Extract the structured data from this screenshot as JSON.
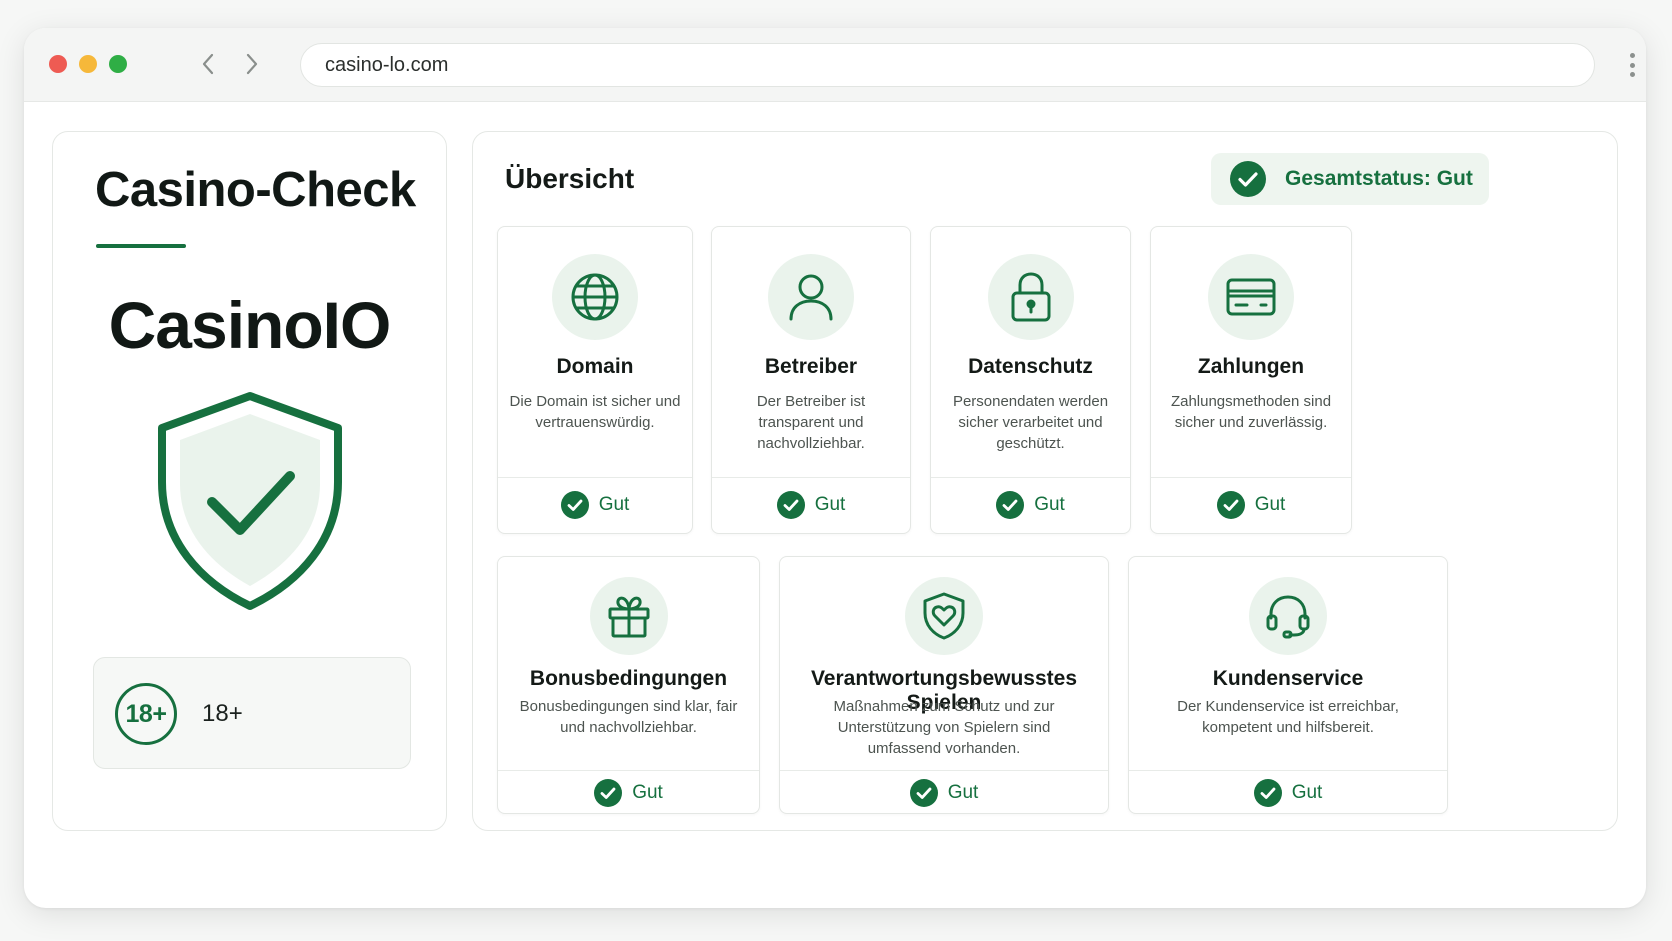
{
  "browser": {
    "url": "casino-lo.com"
  },
  "sidebar": {
    "title": "Casino-Check",
    "casino_name": "CasinoIO",
    "age_badge": "18+",
    "age_label": "18+"
  },
  "overview": {
    "title": "Übersicht",
    "overall_status": "Gesamtstatus: Gut",
    "cards": [
      {
        "title": "Domain",
        "description": "Die Domain ist sicher und vertrauenswürdig.",
        "status": "Gut",
        "icon": "globe-icon"
      },
      {
        "title": "Betreiber",
        "description": "Der Betreiber ist transparent und nachvollziehbar.",
        "status": "Gut",
        "icon": "user-icon"
      },
      {
        "title": "Datenschutz",
        "description": "Personendaten werden sicher verarbeitet und geschützt.",
        "status": "Gut",
        "icon": "lock-icon"
      },
      {
        "title": "Zahlungen",
        "description": "Zahlungsmethoden sind sicher und zuverlässig.",
        "status": "Gut",
        "icon": "credit-card-icon"
      },
      {
        "title": "Bonusbedingungen",
        "description": "Bonusbedingungen sind klar, fair und nachvollziehbar.",
        "status": "Gut",
        "icon": "gift-icon"
      },
      {
        "title": "Verantwortungsbewusstes Spielen",
        "description": "Maßnahmen zum Schutz und zur Unterstützung von Spielern sind umfassend vorhanden.",
        "status": "Gut",
        "icon": "shield-heart-icon"
      },
      {
        "title": "Kundenservice",
        "description": "Der Kundenservice ist erreichbar, kompetent und hilfsbereit.",
        "status": "Gut",
        "icon": "headset-icon"
      }
    ]
  },
  "colors": {
    "accent": "#16703f",
    "accent_light": "#eaf3ec"
  }
}
